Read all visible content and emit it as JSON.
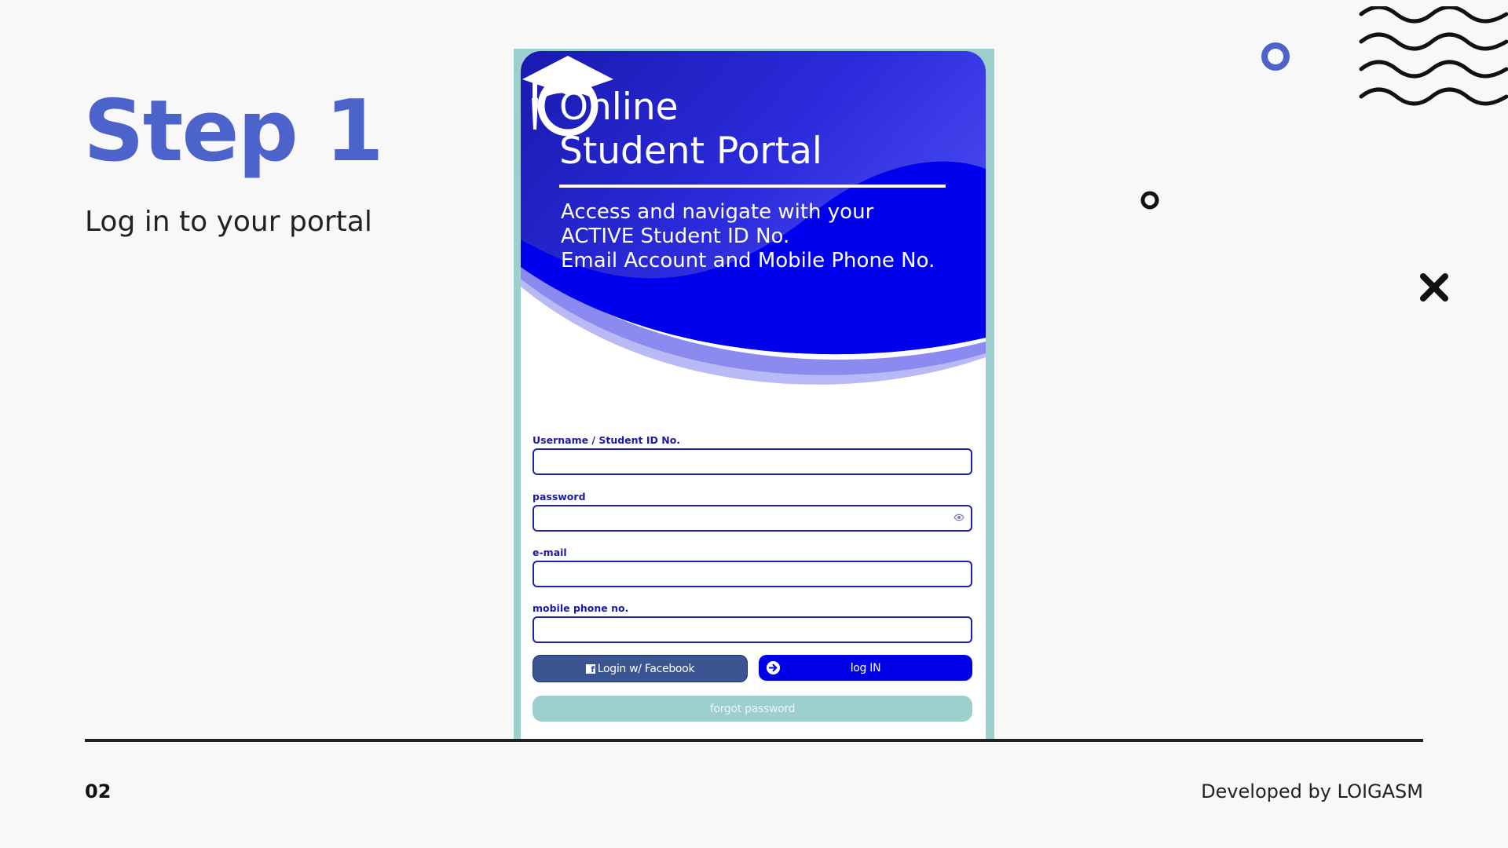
{
  "slide": {
    "title": "Step 1",
    "subtitle": "Log in to your portal",
    "page_number": "02",
    "credit": "Developed by LOIGASM"
  },
  "portal": {
    "title_line1": "Online",
    "title_line2": "Student Portal",
    "desc_line1": "Access and navigate with your",
    "desc_line2": "ACTIVE Student ID No.",
    "desc_line3": "Email Account and Mobile Phone No.",
    "fields": {
      "username_label": "Username / Student ID No.",
      "username_value": "",
      "password_label": "password",
      "password_value": "",
      "email_label": "e-mail",
      "email_value": "",
      "mobile_label": "mobile phone no.",
      "mobile_value": ""
    },
    "buttons": {
      "facebook_label": "Login w/ Facebook",
      "login_label": "log IN",
      "forgot_label": "forgot password"
    }
  },
  "colors": {
    "accent": "#4d63cc",
    "portal_blue": "#0000e8",
    "frame_teal": "#9ecfcf",
    "facebook_blue": "#3a5592"
  },
  "icons": [
    "graduation-cap-icon",
    "eye-icon",
    "facebook-icon",
    "arrow-right-circle-icon",
    "ring-icon",
    "close-x-icon",
    "wavy-lines-icon"
  ]
}
